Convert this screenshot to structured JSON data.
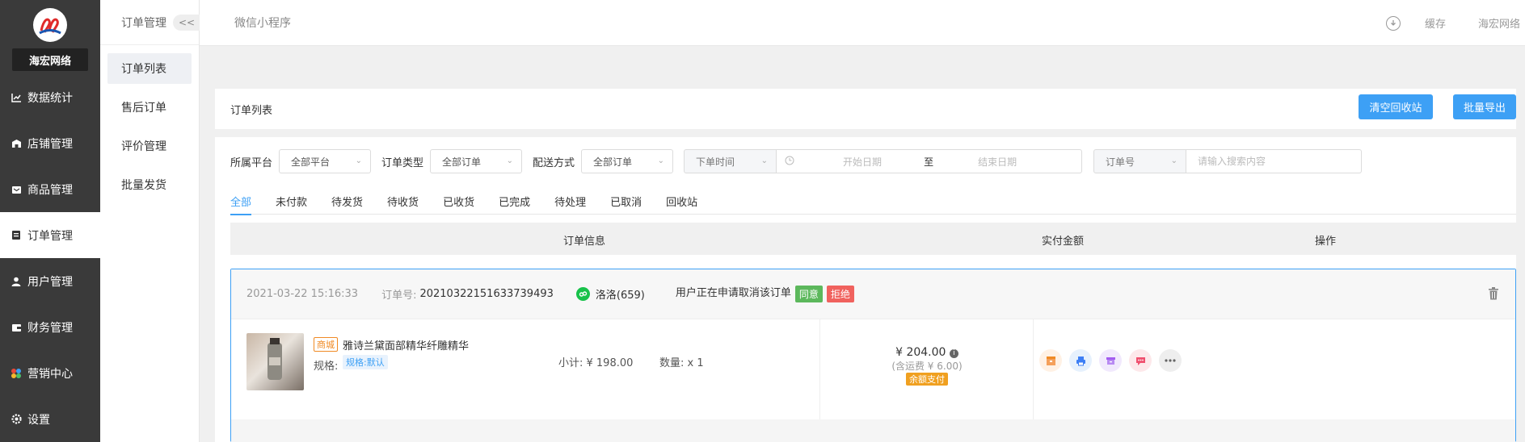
{
  "brand": {
    "name": "海宏网络"
  },
  "sidebar": {
    "items": [
      {
        "label": "数据统计",
        "icon": "chart-icon"
      },
      {
        "label": "店铺管理",
        "icon": "store-icon"
      },
      {
        "label": "商品管理",
        "icon": "goods-icon"
      },
      {
        "label": "订单管理",
        "icon": "order-icon",
        "active": true
      },
      {
        "label": "用户管理",
        "icon": "user-icon"
      },
      {
        "label": "财务管理",
        "icon": "wallet-icon"
      },
      {
        "label": "营销中心",
        "icon": "marketing-icon"
      },
      {
        "label": "设置",
        "icon": "gear-icon"
      }
    ]
  },
  "submenu": {
    "title": "订单管理",
    "collapse": "<<",
    "items": [
      {
        "label": "订单列表",
        "active": true
      },
      {
        "label": "售后订单"
      },
      {
        "label": "评价管理"
      },
      {
        "label": "批量发货"
      }
    ]
  },
  "topbar": {
    "title": "微信小程序",
    "cache": "缓存",
    "user": "海宏网络"
  },
  "panel": {
    "title": "订单列表",
    "clear_recycle": "清空回收站",
    "batch_export": "批量导出"
  },
  "filters": {
    "platform_label": "所属平台",
    "platform_value": "全部平台",
    "type_label": "订单类型",
    "type_value": "全部订单",
    "delivery_label": "配送方式",
    "delivery_value": "全部订单",
    "time_type": "下单时间",
    "start_placeholder": "开始日期",
    "to": "至",
    "end_placeholder": "结束日期",
    "search_type": "订单号",
    "search_placeholder": "请输入搜索内容"
  },
  "tabs": [
    "全部",
    "未付款",
    "待发货",
    "待收货",
    "已收货",
    "已完成",
    "待处理",
    "已取消",
    "回收站"
  ],
  "table": {
    "col_info": "订单信息",
    "col_amount": "实付金额",
    "col_ops": "操作"
  },
  "order": {
    "datetime": "2021-03-22 15:16:33",
    "order_no_label": "订单号:",
    "order_no": "20210322151633739493",
    "buyer": "洛洛(659)",
    "notice": "用户正在申请取消该订单",
    "agree": "同意",
    "reject": "拒绝",
    "source_tag": "商城",
    "product_name": "雅诗兰黛面部精华纤雕精华",
    "spec_label": "规格:",
    "spec_value": "规格:默认",
    "subtotal": "小计: ¥ 198.00",
    "quantity": "数量: x 1",
    "paid": "¥ 204.00",
    "shipping": "(含运费 ¥ 6.00)",
    "pay_method": "余额支付"
  },
  "colors": {
    "accent": "#3da0f5",
    "sidebar_bg": "#3a3a3a",
    "agree": "#5cb85c",
    "reject": "#f0625e",
    "pay_tag": "#f0a020",
    "source_tag": "#f08a24"
  }
}
